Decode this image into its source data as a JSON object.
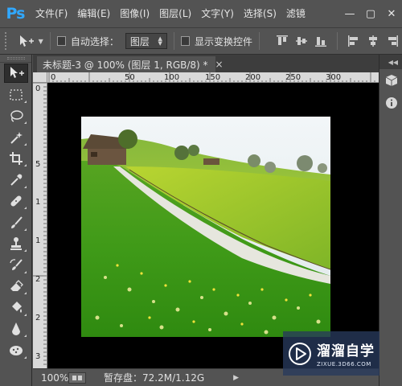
{
  "app": {
    "logo": "Ps",
    "menu": [
      "文件(F)",
      "编辑(E)",
      "图像(I)",
      "图层(L)",
      "文字(Y)",
      "选择(S)",
      "滤镜"
    ],
    "window_buttons": {
      "minimize": "—",
      "maximize": "▢",
      "close": "✕"
    }
  },
  "options_bar": {
    "auto_select_label": "自动选择：",
    "auto_select_checked": false,
    "auto_select_target": "图层",
    "show_transform_label": "显示变换控件",
    "show_transform_checked": false
  },
  "document": {
    "tab_title": "未标题-3 @ 100% (图层 1, RGB/8) *",
    "tab_close": "×"
  },
  "rulers": {
    "horizontal_ticks": [
      "0",
      "50",
      "100",
      "150",
      "200",
      "250",
      "300"
    ],
    "vertical_ticks": [
      "0",
      "5",
      "1",
      "1",
      "2",
      "2",
      "3"
    ]
  },
  "status": {
    "zoom": "100%",
    "scratch_disk": "暂存盘：72.2M/1.12G",
    "arrow": "▶"
  },
  "tools": [
    "move-tool",
    "marquee-tool",
    "lasso-tool",
    "magic-wand-tool",
    "crop-tool",
    "eyedropper-tool",
    "healing-brush-tool",
    "brush-tool",
    "clone-stamp-tool",
    "history-brush-tool",
    "eraser-tool",
    "paint-bucket-tool",
    "blur-tool",
    "sponge-tool"
  ],
  "watermark": {
    "title": "溜溜自学",
    "subtitle": "ZIXUE.3D66.COM"
  },
  "colors": {
    "ui_bg": "#535353",
    "ps_blue": "#31a8ff",
    "canvas_bg": "#000000"
  }
}
